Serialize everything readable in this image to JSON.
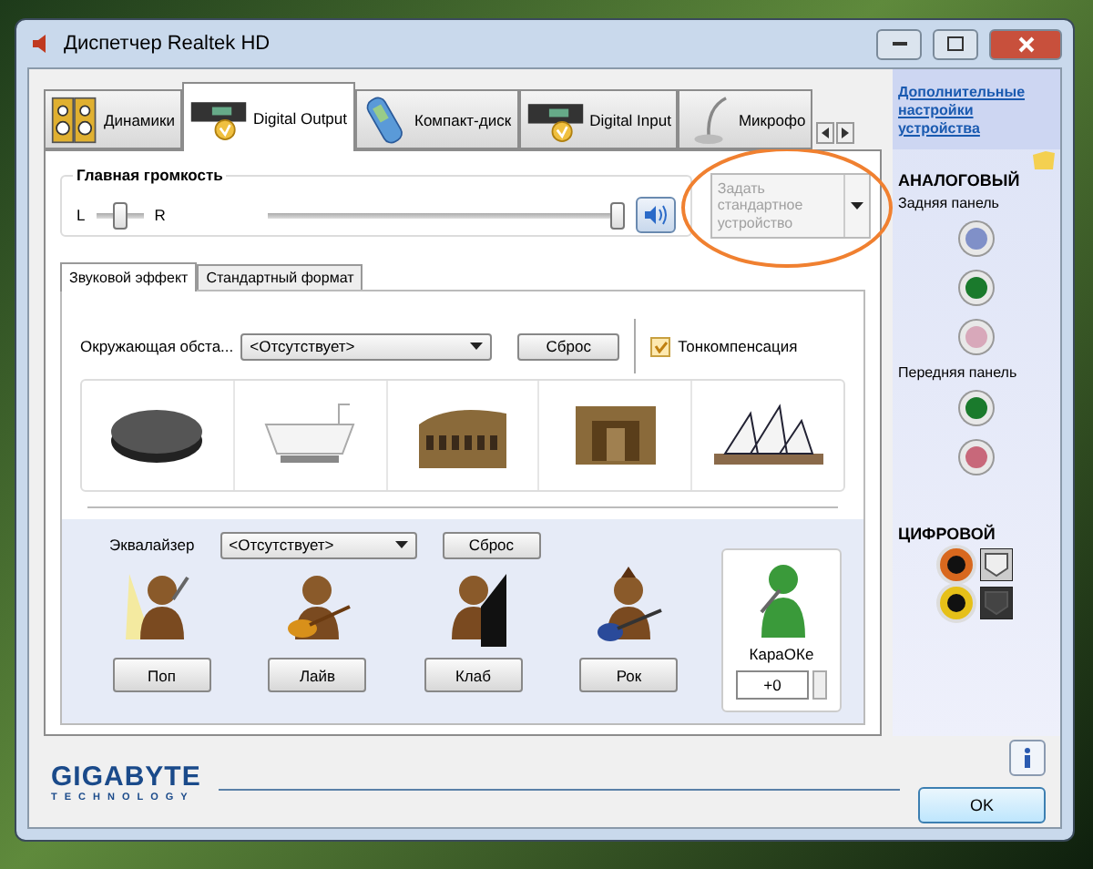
{
  "window": {
    "title": "Диспетчер Realtek HD"
  },
  "device_tabs": [
    {
      "label": "Динамики",
      "kind": "speakers",
      "selected": false
    },
    {
      "label": "Digital Output",
      "kind": "digital",
      "selected": true
    },
    {
      "label": "Компакт-диск",
      "kind": "cd",
      "selected": false
    },
    {
      "label": "Digital Input",
      "kind": "digital",
      "selected": false
    },
    {
      "label": "Микрофо",
      "kind": "mic",
      "selected": false
    }
  ],
  "master_volume": {
    "label": "Главная громкость",
    "left": "L",
    "right": "R",
    "balance": {
      "level": 0.5
    },
    "volume": {
      "level": 1.0
    },
    "muted": false
  },
  "default_device": {
    "text": "Задать стандартное устройство",
    "disabled": true
  },
  "effect_tabs": [
    {
      "label": "Звуковой эффект",
      "selected": true
    },
    {
      "label": "Стандартный формат",
      "selected": false
    }
  ],
  "environment": {
    "label": "Окружающая обста...",
    "value": "<Отсутствует>",
    "reset": "Сброс"
  },
  "loudness": {
    "label": "Тонкомпенсация",
    "checked": true
  },
  "environment_presets": [
    {
      "kind": "disc"
    },
    {
      "kind": "bath"
    },
    {
      "kind": "colosseum"
    },
    {
      "kind": "room"
    },
    {
      "kind": "opera"
    }
  ],
  "equalizer": {
    "label": "Эквалайзер",
    "value": "<Отсутствует>",
    "reset": "Сброс"
  },
  "eq_presets": [
    {
      "label": "Поп",
      "kind": "singer"
    },
    {
      "label": "Лайв",
      "kind": "guitar"
    },
    {
      "label": "Клаб",
      "kind": "piano"
    },
    {
      "label": "Рок",
      "kind": "bass"
    }
  ],
  "karaoke": {
    "label": "КараОКе",
    "value": "+0"
  },
  "sidebar": {
    "link": "Дополнительные настройки устройства",
    "analog": {
      "title": "АНАЛОГОВЫЙ",
      "groups": [
        {
          "label": "Задняя панель",
          "jacks": [
            {
              "color": "#8090c8"
            },
            {
              "color": "#1a7a2c"
            },
            {
              "color": "#d8a8ba"
            }
          ]
        },
        {
          "label": "Передняя панель",
          "jacks": [
            {
              "color": "#1a7a2c"
            },
            {
              "color": "#c8687a"
            }
          ]
        }
      ]
    },
    "digital": {
      "title": "ЦИФРОВОЙ",
      "ports": [
        {
          "color": "#d8681e",
          "kind": "optical-light"
        },
        {
          "color": "#e6c018",
          "kind": "optical-dark"
        }
      ]
    }
  },
  "footer": {
    "brand": "GIGABYTE",
    "brand_sub": "TECHNOLOGY",
    "ok": "OK"
  }
}
